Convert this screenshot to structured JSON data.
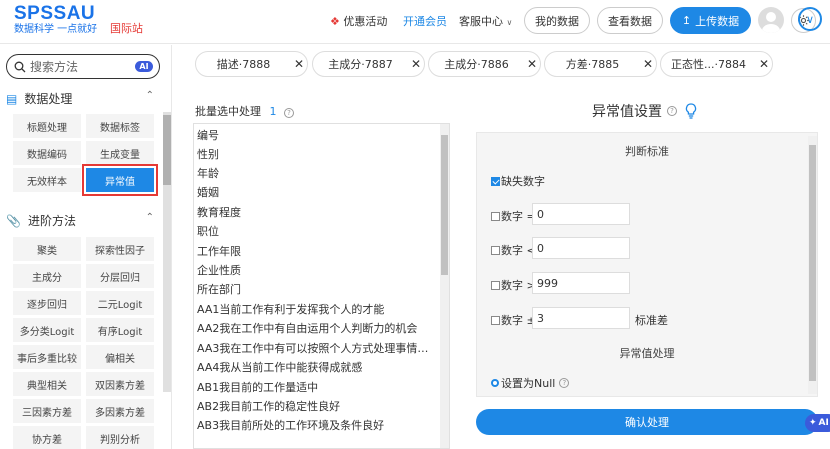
{
  "header": {
    "logo": "SPSSAU",
    "slogan": "数据科学 一点就好",
    "intl": "国际站",
    "nav_promo": "优惠活动",
    "nav_member": "开通会员",
    "nav_service": "客服中心",
    "btn_my_data": "我的数据",
    "btn_view_data": "查看数据",
    "btn_upload": "上传数据"
  },
  "sidebar": {
    "search_placeholder": "搜索方法",
    "ai_label": "AI",
    "section1": "数据处理",
    "section1_items": [
      "标题处理",
      "数据标签",
      "数据编码",
      "生成变量",
      "无效样本",
      "异常值"
    ],
    "section2": "进阶方法",
    "section2_items": [
      "聚类",
      "探索性因子",
      "主成分",
      "分层回归",
      "逐步回归",
      "二元Logit",
      "多分类Logit",
      "有序Logit",
      "事后多重比较",
      "偏相关",
      "典型相关",
      "双因素方差",
      "三因素方差",
      "多因素方差",
      "协方差",
      "判别分析"
    ]
  },
  "tabs": [
    {
      "label": "描述·7888"
    },
    {
      "label": "主成分·7887"
    },
    {
      "label": "主成分·7886"
    },
    {
      "label": "方差·7885"
    },
    {
      "label": "正态性...·7884"
    }
  ],
  "batch": {
    "label": "批量选中处理",
    "count": "1"
  },
  "variables": [
    "编号",
    "性别",
    "年龄",
    "婚姻",
    "教育程度",
    "职位",
    "工作年限",
    "企业性质",
    "所在部门",
    "AA1当前工作有利于发挥我个人的才能",
    "AA2我在工作中有自由运用个人判断力的机会",
    "AA3我在工作中有可以按照个人方式处理事情的…",
    "AA4我从当前工作中能获得成就感",
    "AB1我目前的工作量适中",
    "AB2我目前工作的稳定性良好",
    "AB3我目前所处的工作环境及条件良好"
  ],
  "panel": {
    "title": "异常值设置",
    "criteria_header": "判断标准",
    "missing_label": "缺失数字",
    "eq_label": "数字 =",
    "eq_value": "0",
    "lt_label": "数字 <",
    "lt_value": "0",
    "gt_label": "数字 >",
    "gt_value": "999",
    "pm_label": "数字 ±",
    "pm_value": "3",
    "pm_unit": "标准差",
    "handling_header": "异常值处理",
    "null_label": "设置为Null",
    "confirm": "确认处理"
  },
  "ai_float": "AI"
}
